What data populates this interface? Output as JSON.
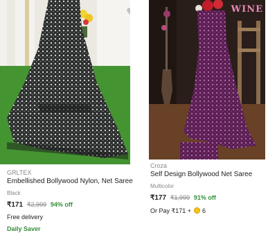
{
  "products": [
    {
      "brand": "GRLTEX",
      "title": "Embellished Bollywood Nylon, Net Saree",
      "color": "Black",
      "price": "₹171",
      "mrp": "₹2,999",
      "discount": "94% off",
      "delivery": "Free delivery",
      "badge": "Daily Saver",
      "wishlist_icon": "heart-icon"
    },
    {
      "brand": "Croza",
      "title": "Self Design Bollywood Net Saree",
      "color": "Multicolor",
      "price": "₹177",
      "mrp": "₹1,999",
      "discount": "91% off",
      "or_pay_prefix": "Or Pay ₹171 +",
      "coins": "6",
      "watermark": "WINE",
      "coin_icon": "supercoin-icon"
    }
  ],
  "colors": {
    "discount_green": "#388e3c",
    "muted_text": "#878787",
    "coin_yellow": "#f7c415"
  }
}
